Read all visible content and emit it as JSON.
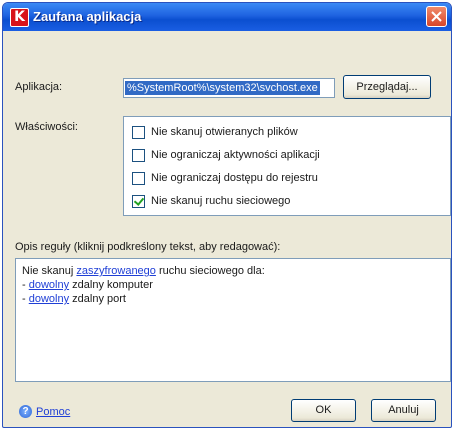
{
  "window": {
    "title": "Zaufana aplikacja",
    "app_icon_letter": "K",
    "close_symbol": "✕"
  },
  "application": {
    "label": "Aplikacja:",
    "path": "%SystemRoot%\\system32\\svchost.exe",
    "browse_label": "Przeglądaj..."
  },
  "properties": {
    "label": "Właściwości:",
    "items": [
      {
        "label": "Nie skanuj otwieranych plików",
        "checked": false
      },
      {
        "label": "Nie ograniczaj aktywności aplikacji",
        "checked": false
      },
      {
        "label": "Nie ograniczaj dostępu do rejestru",
        "checked": false
      },
      {
        "label": "Nie skanuj ruchu sieciowego",
        "checked": true
      }
    ]
  },
  "rule": {
    "label": "Opis reguły (kliknij podkreślony tekst, aby redagować):",
    "line1_prefix": "Nie skanuj ",
    "line1_link": "zaszyfrowanego",
    "line1_suffix": " ruchu sieciowego dla:",
    "line2_prefix": "- ",
    "line2_link": "dowolny",
    "line2_suffix": " zdalny komputer",
    "line3_prefix": "- ",
    "line3_link": "dowolny",
    "line3_suffix": " zdalny port"
  },
  "footer": {
    "help_label": "Pomoc",
    "ok_label": "OK",
    "cancel_label": "Anuluj"
  }
}
